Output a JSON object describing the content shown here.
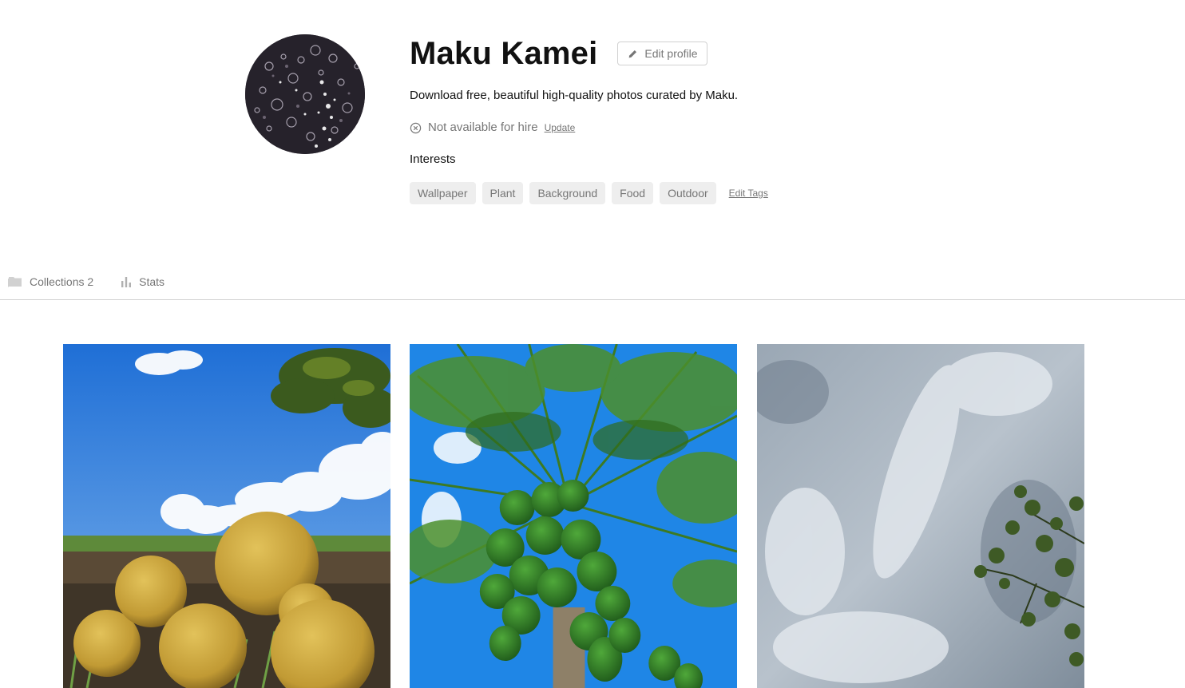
{
  "profile": {
    "name": "Maku Kamei",
    "edit_profile_label": "Edit profile",
    "bio": "Download free, beautiful high-quality photos curated by Maku.",
    "hire_status": "Not available for hire",
    "hire_update_label": "Update",
    "interests_title": "Interests",
    "interests": [
      "Wallpaper",
      "Plant",
      "Background",
      "Food",
      "Outdoor"
    ],
    "edit_tags_label": "Edit Tags"
  },
  "tabs": {
    "collections_label": "Collections 2",
    "stats_label": "Stats"
  },
  "photos": [
    {
      "subject": "citrus fruits on ground under blue sky"
    },
    {
      "subject": "papaya tree with green fruits"
    },
    {
      "subject": "cloudy sky with tree branch"
    }
  ],
  "colors": {
    "text_primary": "#111111",
    "text_secondary": "#767676",
    "tag_bg": "#eeeeee",
    "border": "#d1d1d1"
  }
}
